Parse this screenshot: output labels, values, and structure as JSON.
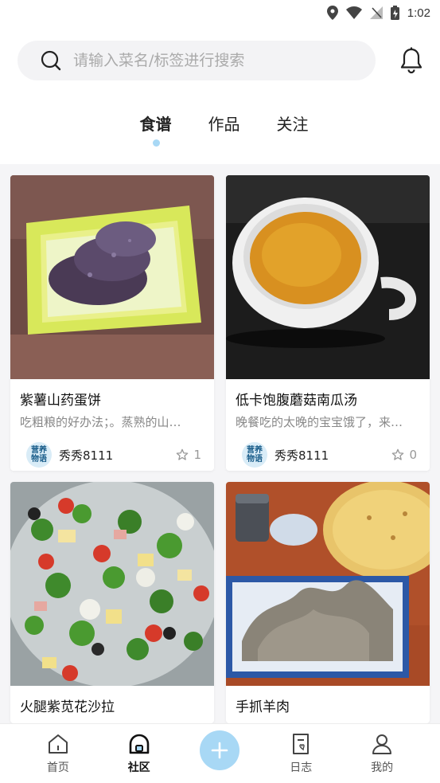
{
  "status_bar": {
    "time": "1:02"
  },
  "search": {
    "placeholder": "请输入菜名/标签进行搜索"
  },
  "tabs": [
    {
      "label": "食谱",
      "active": true
    },
    {
      "label": "作品",
      "active": false
    },
    {
      "label": "关注",
      "active": false
    }
  ],
  "cards": [
    {
      "title": "紫薯山药蛋饼",
      "desc": "吃粗粮的好办法；。蒸熟的山…",
      "author": "秀秀8111",
      "likes": "1",
      "avatar_text": "营养物语"
    },
    {
      "title": "低卡饱腹蘑菇南瓜汤",
      "desc": "晚餐吃的太晚的宝宝饿了，来…",
      "author": "秀秀8111",
      "likes": "0",
      "avatar_text": "营养物语"
    },
    {
      "title": "火腿紫苋花沙拉",
      "desc": "",
      "author": "",
      "likes": "",
      "avatar_text": ""
    },
    {
      "title": "手抓羊肉",
      "desc": "",
      "author": "",
      "likes": "",
      "avatar_text": ""
    }
  ],
  "bottom_nav": [
    {
      "label": "首页",
      "icon": "home-icon"
    },
    {
      "label": "社区",
      "icon": "community-icon"
    },
    {
      "label": "",
      "icon": "plus-icon"
    },
    {
      "label": "日志",
      "icon": "journal-icon"
    },
    {
      "label": "我的",
      "icon": "profile-icon"
    }
  ],
  "colors": {
    "accent": "#a8d8f5",
    "search_bg": "#f3f3f5",
    "feed_bg": "#f5f5f7"
  }
}
